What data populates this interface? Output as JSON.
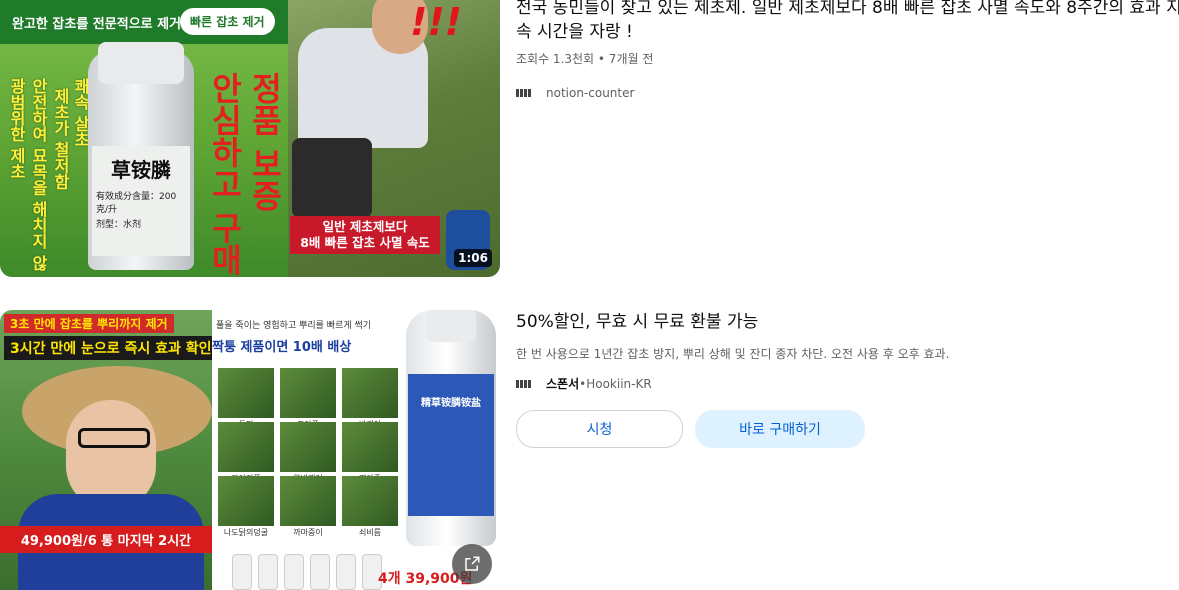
{
  "result1": {
    "title": "전국 농민들이 찾고 있는 제초제. 일반 제초제보다 8배 빠른 잡초 사멸 속도와 8주간의 효과 지속 시간을 자랑 !",
    "meta": "조회수 1.3천회 • 7개월 전",
    "channel": "notion-counter",
    "thumbnail": {
      "banner_left": "완고한 잡초를 전문적으로 제거",
      "banner_pill": "빠른 잡초 제거",
      "bottle_name": "草铵膦",
      "bottle_spec": "有效成分含量：200克/升",
      "bottle_type": "剂型：水剂",
      "yellow_col1": "광범위한 제초",
      "yellow_col2": "안전하여 묘목을 해치지 않",
      "yellow_col3": "제초가 철저함",
      "yellow_col4": "쾌속 살초",
      "red_col1": "안심하고 구매",
      "red_col2": "정품 보증",
      "caption_line1": "일반 제초제보다",
      "caption_line2": "8배 빠른 잡초 사멸 속도",
      "duration": "1:06"
    }
  },
  "result2": {
    "title": "50%할인, 무효 시 무료 환불 가능",
    "description": "한 번 사용으로 1년간 잡초 방지, 뿌리 상해 및 잔디 종자 차단. 오전 사용 후 오후 효과.",
    "sponsor_label": "스폰서",
    "separator": " • ",
    "advertiser": "Hookiin-KR",
    "buttons": {
      "watch": "시청",
      "buy": "바로 구매하기"
    },
    "thumbnail": {
      "top_line1": "3초 만에 잡초를 뿌리까지 제거",
      "top_line2": "3시간 만에 눈으로 즉시 효과 확인",
      "price_banner": "49,900원/6 통 마지막 2시간",
      "mid_header1": "풀을 죽이는 영험하고 뿌리를 빠르게 썩기",
      "mid_header2": "짝퉁 제품이면 10배 배상",
      "weeds": [
        "돌피",
        "포아풀",
        "바랭이",
        "강아지풀",
        "왕바랭이",
        "명아주",
        "나도닭의덩굴",
        "까마중이",
        "쇠비름"
      ],
      "bottle_label": "精草铵膦铵盐",
      "bottom_price": "4개 39,900원"
    }
  }
}
